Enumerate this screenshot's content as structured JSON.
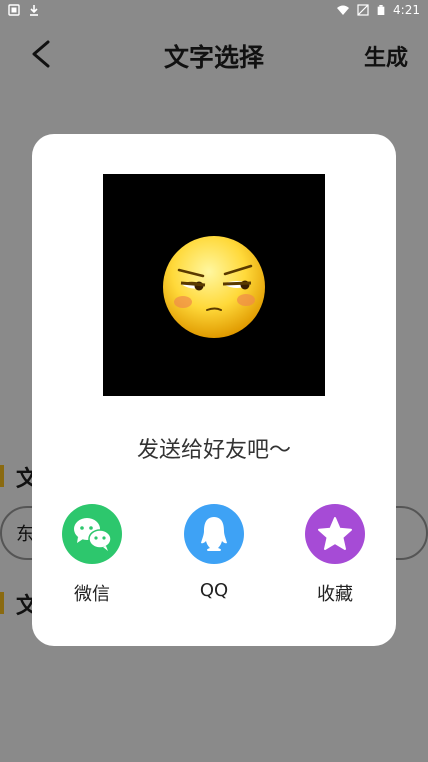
{
  "status_bar": {
    "time": "4:21",
    "left_icons": [
      "sim-icon",
      "download-icon"
    ],
    "right_icons": [
      "wifi-icon",
      "no-signal-icon",
      "battery-icon"
    ]
  },
  "app_bar": {
    "title": "文字选择",
    "action_label": "生成",
    "back_icon": "back-arrow-icon"
  },
  "background": {
    "section1_label": "文",
    "input_text": "东",
    "section2_label": "文",
    "accent_color": "#f0b400"
  },
  "dialog": {
    "preview_icon": "smirk-emoji",
    "prompt": "发送给好友吧～",
    "share_options": [
      {
        "label": "微信",
        "icon": "wechat-icon",
        "color": "#2dc76d"
      },
      {
        "label": "QQ",
        "icon": "qq-penguin-icon",
        "color": "#3ea2f5"
      },
      {
        "label": "收藏",
        "icon": "star-icon",
        "color": "#a64bd6"
      }
    ]
  }
}
